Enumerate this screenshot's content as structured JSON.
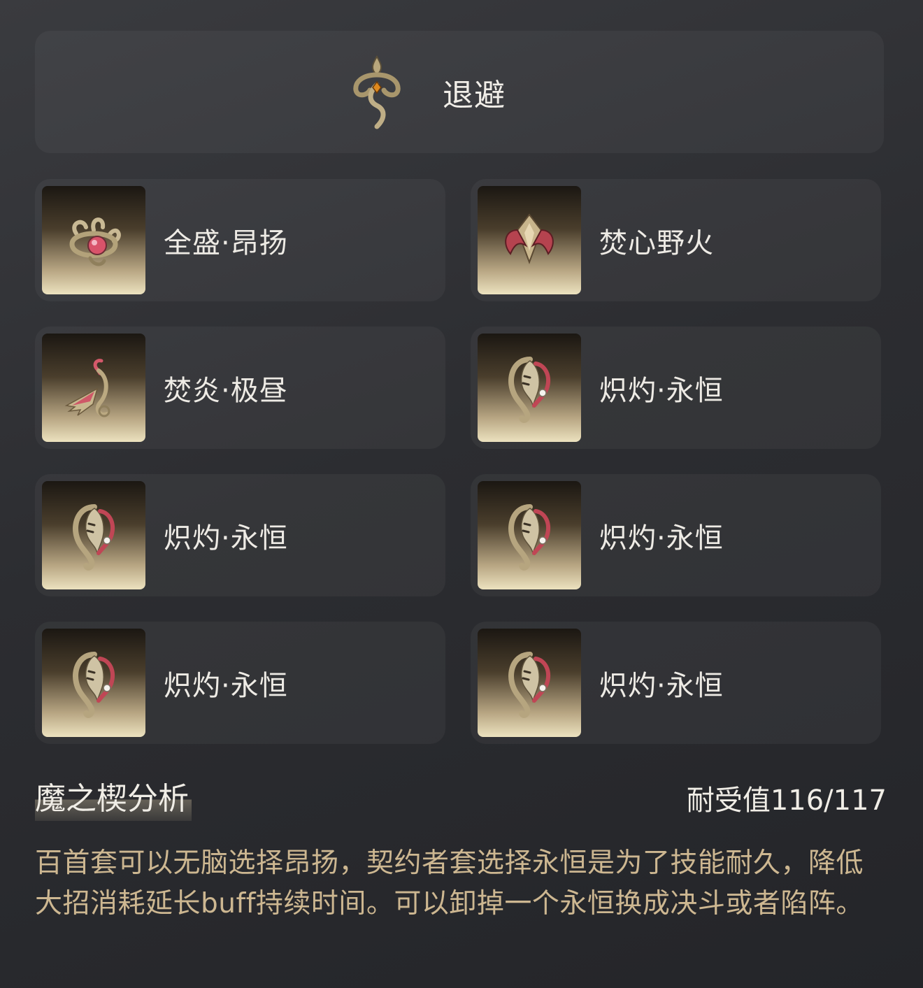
{
  "header": {
    "title": "退避",
    "icon": "serpent-emblem-icon"
  },
  "items": [
    {
      "label": "全盛·昂扬",
      "icon": "multi-head-serpent-icon"
    },
    {
      "label": "焚心野火",
      "icon": "flame-crest-icon"
    },
    {
      "label": "焚炎·极昼",
      "icon": "phoenix-icon"
    },
    {
      "label": "炽灼·永恒",
      "icon": "mask-curl-icon"
    },
    {
      "label": "炽灼·永恒",
      "icon": "mask-curl-icon"
    },
    {
      "label": "炽灼·永恒",
      "icon": "mask-curl-icon"
    },
    {
      "label": "炽灼·永恒",
      "icon": "mask-curl-icon"
    },
    {
      "label": "炽灼·永恒",
      "icon": "mask-curl-icon"
    }
  ],
  "analysis": {
    "title": "魔之楔分析",
    "endurance": "耐受值116/117",
    "text": "百首套可以无脑选择昂扬，契约者套选择永恒是为了技能耐久，降低大招消耗延长buff持续时间。可以卸掉一个永恒换成决斗或者陷阵。"
  },
  "colors": {
    "accent_text": "#cdb791",
    "card_bg": "rgba(255,255,255,0.045)"
  }
}
